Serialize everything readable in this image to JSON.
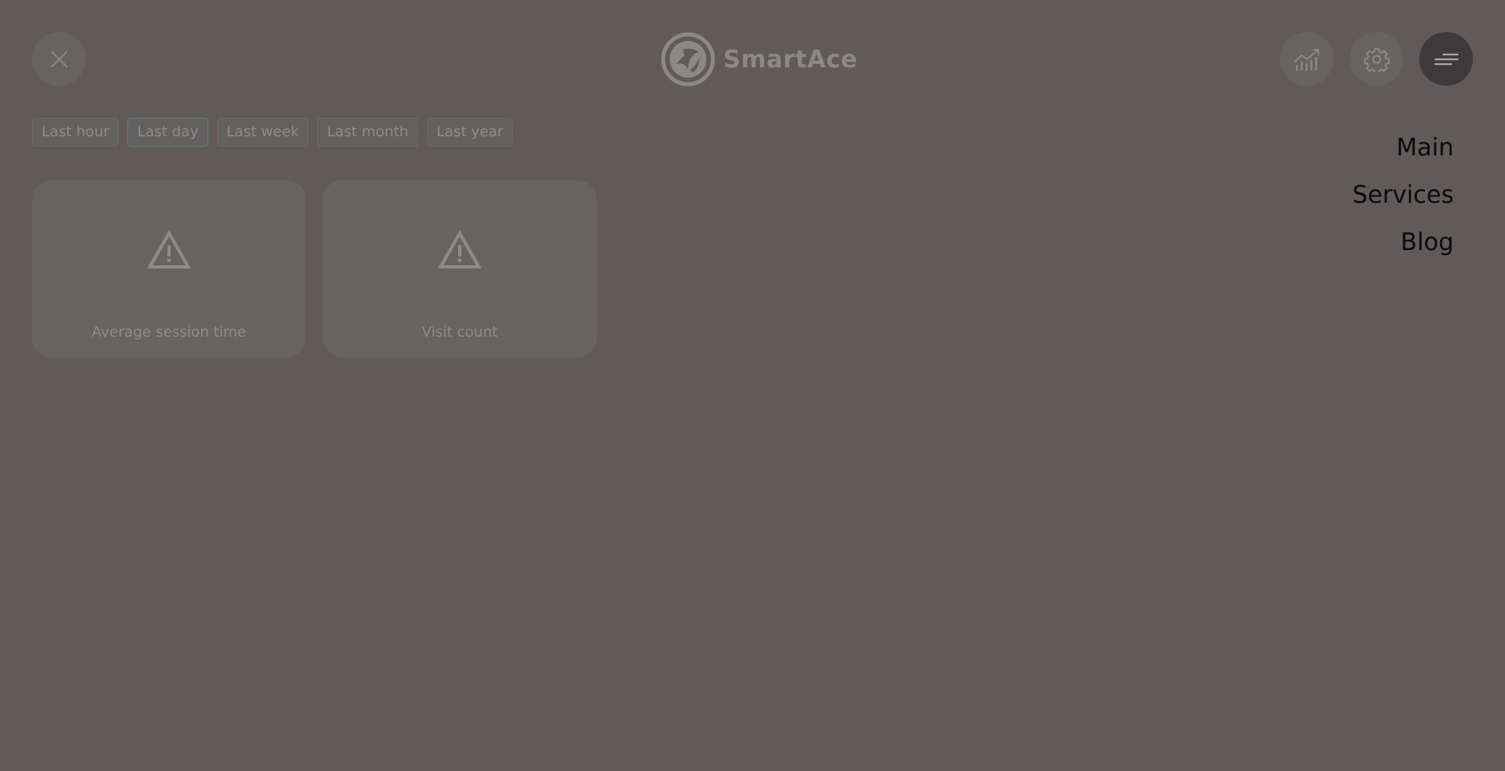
{
  "header": {
    "logo_text": "SmartAce",
    "close_icon": "close-icon",
    "analytics_icon": "chart-icon",
    "settings_icon": "gear-icon",
    "menu_icon": "menu-icon"
  },
  "filters": {
    "items": [
      "Last hour",
      "Last day",
      "Last week",
      "Last month",
      "Last year"
    ],
    "active": "Last day",
    "active_color": "#4e8c73"
  },
  "cards": [
    {
      "label": "Average session time",
      "icon": "warning-icon"
    },
    {
      "label": "Visit count",
      "icon": "warning-icon"
    }
  ],
  "nav": {
    "items": [
      "Main",
      "Services",
      "Blog"
    ]
  },
  "colors": {
    "overlay_background": "#605b5a",
    "card_background": "#676362",
    "menu_button": "#3c3a3a"
  }
}
